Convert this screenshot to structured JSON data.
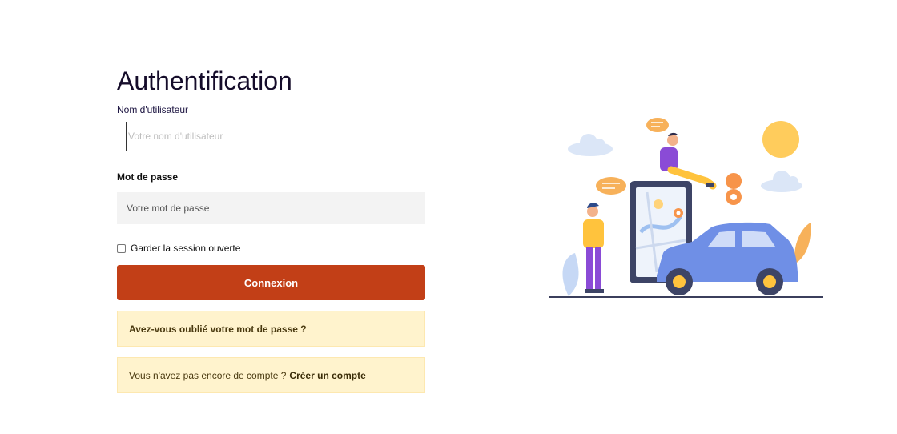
{
  "page": {
    "title": "Authentification"
  },
  "form": {
    "username_label": "Nom d'utilisateur",
    "username_placeholder": "Votre nom d'utilisateur",
    "password_label": "Mot de passe",
    "password_placeholder": "Votre mot de passe",
    "remember_label": "Garder la session ouverte",
    "login_button": "Connexion"
  },
  "notices": {
    "forgot_password": "Avez-vous oublié votre mot de passe ?",
    "no_account_text": "Vous n'avez pas encore de compte ?",
    "create_account_link": "Créer un compte"
  },
  "colors": {
    "primary_button": "#c23f17",
    "notice_bg": "#fff3cd"
  }
}
